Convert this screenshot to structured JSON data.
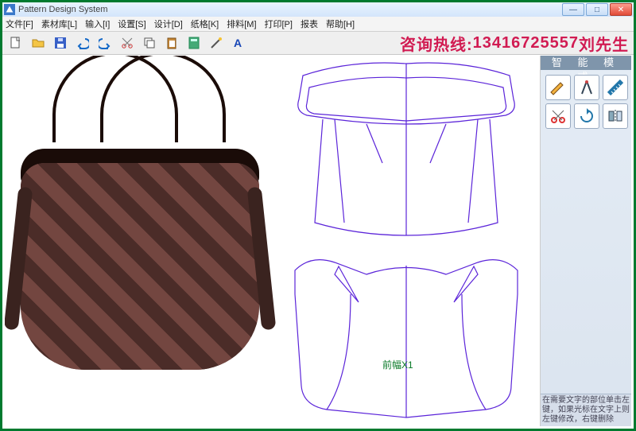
{
  "app_title": "Pattern Design System",
  "menu": [
    "文件[F]",
    "素材库[L]",
    "输入[I]",
    "设置[S]",
    "设计[D]",
    "纸格[K]",
    "排料[M]",
    "打印[P]",
    "报表",
    "帮助[H]"
  ],
  "toolbar_icons": [
    "new",
    "open",
    "save",
    "undo",
    "redo",
    "cut",
    "copy",
    "paste",
    "calc",
    "wizard",
    "text"
  ],
  "promo": {
    "prefix": "咨询热线:",
    "phone": "13416725557",
    "name": "刘先生"
  },
  "side": {
    "header": "智 能 模 式",
    "tools": [
      "pencil",
      "compass",
      "ruler",
      "scissors",
      "rotate",
      "mirror"
    ],
    "hint": "在需要文字的部位单击左键，如果光标在文字上则左键修改，右键删除"
  },
  "piece_label": "前幅X1",
  "window_buttons": {
    "min": "—",
    "max": "□",
    "close": "✕"
  }
}
